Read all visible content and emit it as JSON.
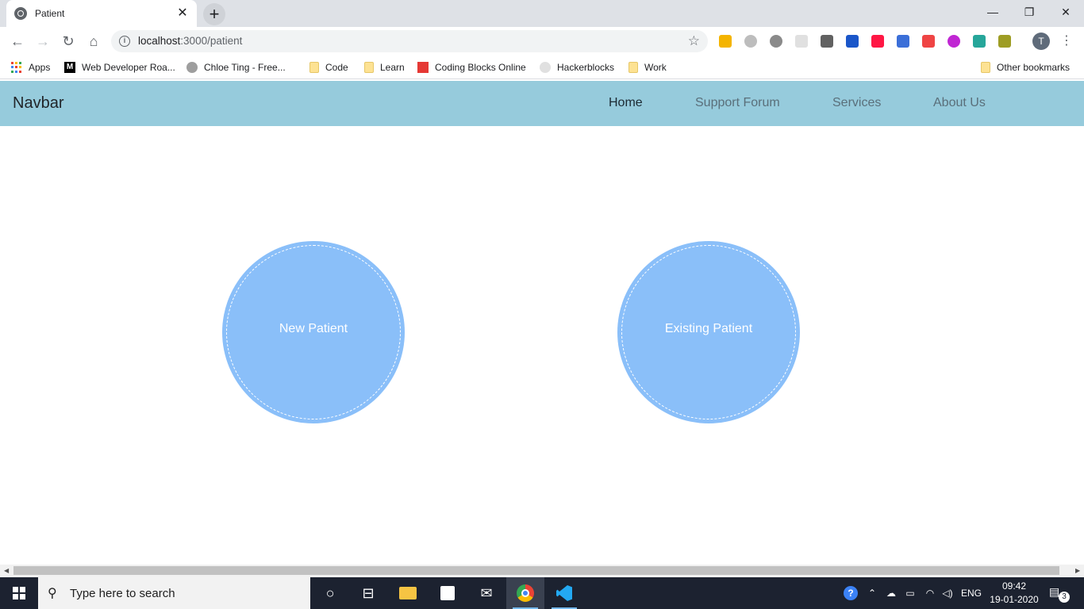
{
  "browser": {
    "tab_title": "Patient",
    "tab_close": "✕",
    "new_tab": "+",
    "url_host": "localhost",
    "url_path": ":3000/patient",
    "profile_initial": "T",
    "window_controls": {
      "minimize": "—",
      "restore": "❐",
      "close": "✕"
    }
  },
  "bookmarks": {
    "items": [
      {
        "label": "Apps",
        "icon": "apps-grid-icon"
      },
      {
        "label": "Web Developer Roa...",
        "icon": "medium-icon"
      },
      {
        "label": "Chloe Ting - Free...",
        "icon": "avatar-icon"
      },
      {
        "label": "Code",
        "icon": "folder-icon"
      },
      {
        "label": "Learn",
        "icon": "folder-icon"
      },
      {
        "label": "Coding Blocks Online",
        "icon": "coding-blocks-icon"
      },
      {
        "label": "Hackerblocks",
        "icon": "hackerblocks-icon"
      },
      {
        "label": "Work",
        "icon": "folder-icon"
      }
    ],
    "other": "Other bookmarks"
  },
  "navbar": {
    "brand": "Navbar",
    "links": [
      {
        "label": "Home",
        "active": true
      },
      {
        "label": "Support Forum",
        "active": false
      },
      {
        "label": "Services",
        "active": false
      },
      {
        "label": "About Us",
        "active": false
      }
    ],
    "background": "#96cbdc"
  },
  "main": {
    "options": [
      {
        "label": "New Patient"
      },
      {
        "label": "Existing Patient"
      }
    ],
    "circle_color": "#8abff9"
  },
  "taskbar": {
    "search_placeholder": "Type here to search",
    "language": "ENG",
    "time": "09:42",
    "date": "19-01-2020",
    "notification_count": "3"
  }
}
